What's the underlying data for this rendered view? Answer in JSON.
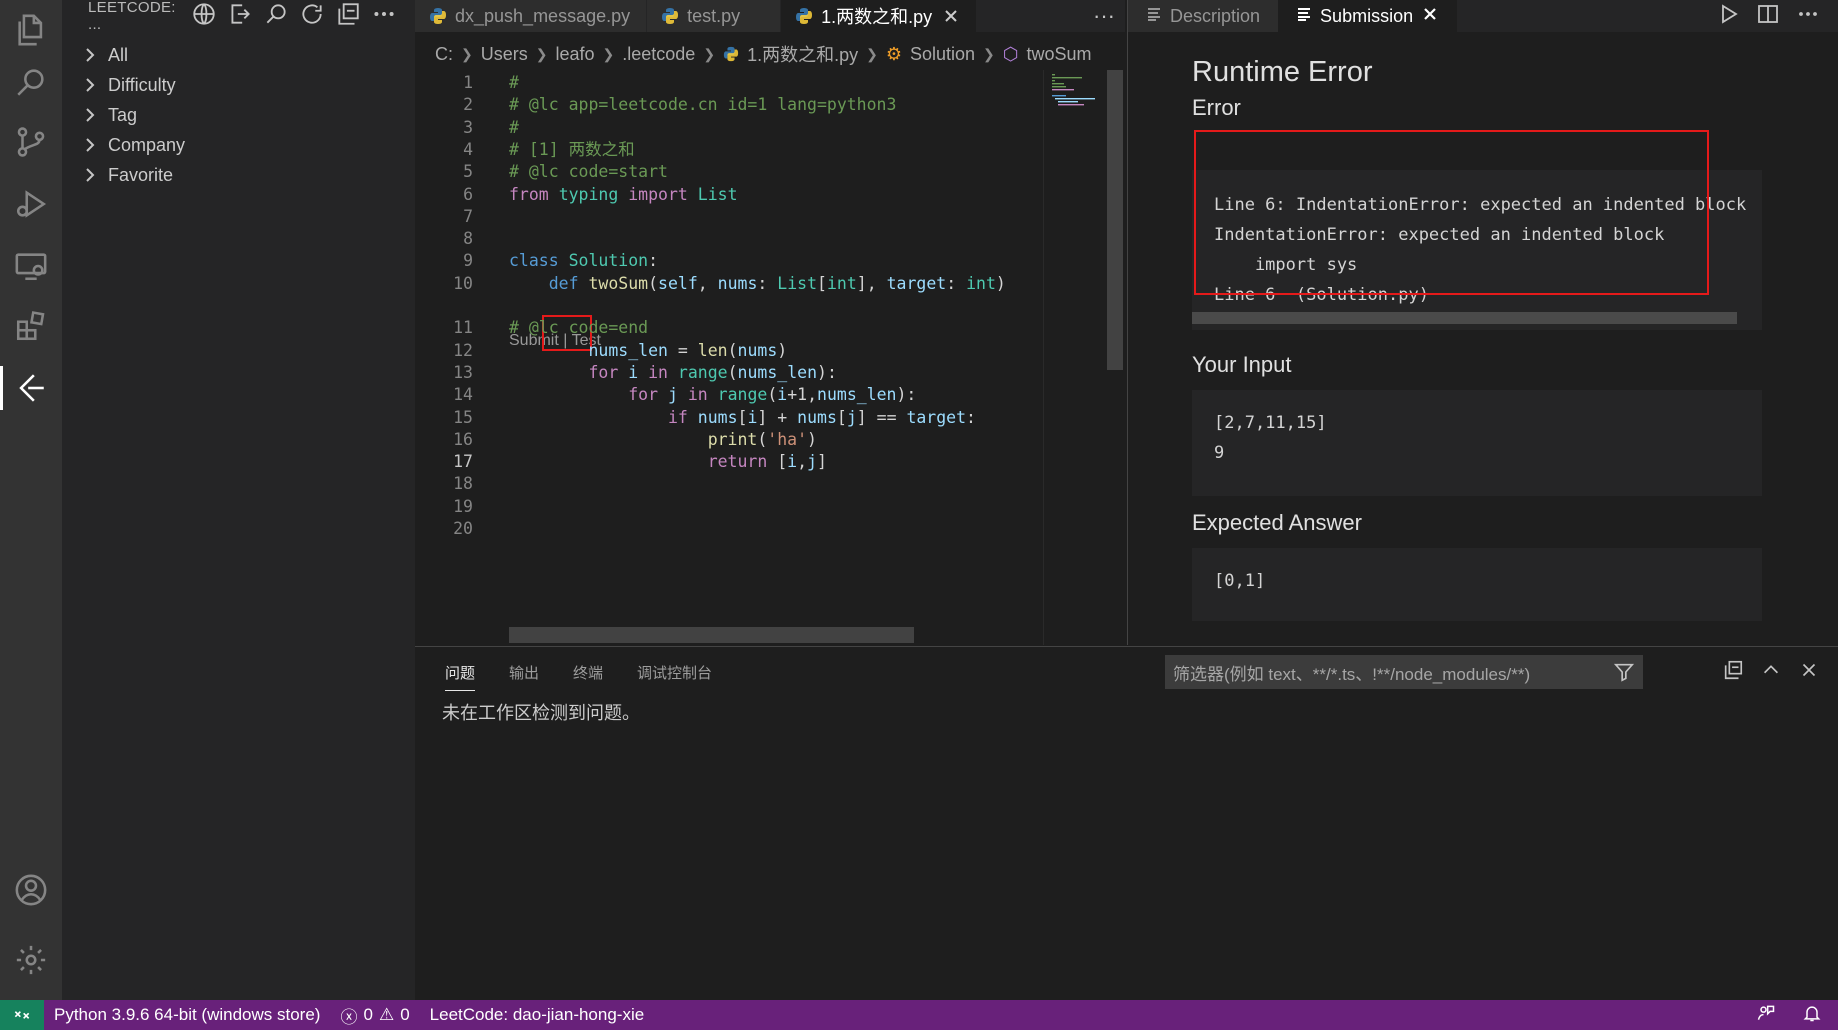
{
  "sidebar": {
    "title": "LEETCODE: ...",
    "items": [
      {
        "label": "All"
      },
      {
        "label": "Difficulty"
      },
      {
        "label": "Tag"
      },
      {
        "label": "Company"
      },
      {
        "label": "Favorite"
      }
    ]
  },
  "editor": {
    "tabs": [
      {
        "label": "dx_push_message.py"
      },
      {
        "label": "test.py"
      },
      {
        "label": "1.两数之和.py"
      }
    ],
    "breadcrumb": [
      "C:",
      "Users",
      "leafo",
      ".leetcode",
      "1.两数之和.py",
      "Solution",
      "twoSum"
    ],
    "codelens": {
      "submit": "Submit",
      "sep": " | ",
      "test": "Test"
    },
    "lines": [
      {
        "n": "1",
        "parts": [
          [
            "c-com",
            "#"
          ]
        ]
      },
      {
        "n": "2",
        "parts": [
          [
            "c-com",
            "# @lc app=leetcode.cn id=1 lang=python3"
          ]
        ]
      },
      {
        "n": "3",
        "parts": [
          [
            "c-com",
            "#"
          ]
        ]
      },
      {
        "n": "4",
        "parts": [
          [
            "c-com",
            "# [1] 两数之和"
          ]
        ]
      },
      {
        "n": "5",
        "parts": [
          [
            "c-com",
            "# @lc code=start"
          ]
        ]
      },
      {
        "n": "6",
        "parts": [
          [
            "c-kw2",
            "from"
          ],
          [
            "c-def",
            " "
          ],
          [
            "c-cls",
            "typing"
          ],
          [
            "c-def",
            " "
          ],
          [
            "c-kw2",
            "import"
          ],
          [
            "c-def",
            " "
          ],
          [
            "c-cls",
            "List"
          ]
        ]
      },
      {
        "n": "7",
        "parts": []
      },
      {
        "n": "8",
        "parts": []
      },
      {
        "n": "9",
        "parts": [
          [
            "c-kw",
            "class"
          ],
          [
            "c-def",
            " "
          ],
          [
            "c-cls",
            "Solution"
          ],
          [
            "c-def",
            ":"
          ]
        ]
      },
      {
        "n": "10",
        "parts": [
          [
            "c-def",
            "    "
          ],
          [
            "c-kw",
            "def"
          ],
          [
            "c-def",
            " "
          ],
          [
            "c-fn",
            "twoSum"
          ],
          [
            "c-def",
            "("
          ],
          [
            "c-var",
            "self"
          ],
          [
            "c-def",
            ", "
          ],
          [
            "c-var",
            "nums"
          ],
          [
            "c-def",
            ": "
          ],
          [
            "c-cls",
            "List"
          ],
          [
            "c-def",
            "["
          ],
          [
            "c-cls",
            "int"
          ],
          [
            "c-def",
            "], "
          ],
          [
            "c-var",
            "target"
          ],
          [
            "c-def",
            ": "
          ],
          [
            "c-cls",
            "int"
          ],
          [
            "c-def",
            ")"
          ]
        ]
      },
      {
        "n": "11",
        "parts": [
          [
            "c-com",
            "# @lc code=end"
          ]
        ]
      },
      {
        "n": "12",
        "parts": [
          [
            "c-def",
            "        "
          ],
          [
            "c-var",
            "nums_len"
          ],
          [
            "c-def",
            " = "
          ],
          [
            "c-fn",
            "len"
          ],
          [
            "c-def",
            "("
          ],
          [
            "c-var",
            "nums"
          ],
          [
            "c-def",
            ")"
          ]
        ]
      },
      {
        "n": "13",
        "parts": [
          [
            "c-def",
            "        "
          ],
          [
            "c-kw2",
            "for"
          ],
          [
            "c-def",
            " "
          ],
          [
            "c-var",
            "i"
          ],
          [
            "c-def",
            " "
          ],
          [
            "c-kw2",
            "in"
          ],
          [
            "c-def",
            " "
          ],
          [
            "c-cls",
            "range"
          ],
          [
            "c-def",
            "("
          ],
          [
            "c-var",
            "nums_len"
          ],
          [
            "c-def",
            "):"
          ]
        ]
      },
      {
        "n": "14",
        "parts": [
          [
            "c-def",
            "            "
          ],
          [
            "c-kw2",
            "for"
          ],
          [
            "c-def",
            " "
          ],
          [
            "c-var",
            "j"
          ],
          [
            "c-def",
            " "
          ],
          [
            "c-kw2",
            "in"
          ],
          [
            "c-def",
            " "
          ],
          [
            "c-cls",
            "range"
          ],
          [
            "c-def",
            "("
          ],
          [
            "c-var",
            "i"
          ],
          [
            "c-def",
            "+1,"
          ],
          [
            "c-var",
            "nums_len"
          ],
          [
            "c-def",
            "):"
          ]
        ]
      },
      {
        "n": "15",
        "parts": [
          [
            "c-def",
            "                "
          ],
          [
            "c-kw2",
            "if"
          ],
          [
            "c-def",
            " "
          ],
          [
            "c-var",
            "nums"
          ],
          [
            "c-def",
            "["
          ],
          [
            "c-var",
            "i"
          ],
          [
            "c-def",
            "] + "
          ],
          [
            "c-var",
            "nums"
          ],
          [
            "c-def",
            "["
          ],
          [
            "c-var",
            "j"
          ],
          [
            "c-def",
            "] == "
          ],
          [
            "c-var",
            "target"
          ],
          [
            "c-def",
            ":"
          ]
        ]
      },
      {
        "n": "16",
        "parts": [
          [
            "c-def",
            "                    "
          ],
          [
            "c-fn",
            "print"
          ],
          [
            "c-def",
            "("
          ],
          [
            "c-str",
            "'ha'"
          ],
          [
            "c-def",
            ")"
          ]
        ]
      },
      {
        "n": "17",
        "parts": [
          [
            "c-def",
            "                    "
          ],
          [
            "c-kw2",
            "return"
          ],
          [
            "c-def",
            " ["
          ],
          [
            "c-var",
            "i"
          ],
          [
            "c-def",
            ","
          ],
          [
            "c-var",
            "j"
          ],
          [
            "c-def",
            "]"
          ]
        ]
      },
      {
        "n": "18",
        "parts": []
      },
      {
        "n": "19",
        "parts": []
      },
      {
        "n": "20",
        "parts": []
      }
    ]
  },
  "right": {
    "tabs": [
      {
        "label": "Description"
      },
      {
        "label": "Submission"
      }
    ],
    "title": "Runtime Error",
    "error_label": "Error",
    "error_text": "Line 6: IndentationError: expected an indented block\nIndentationError: expected an indented block\n    import sys\nLine 6  (Solution.py)",
    "input_label": "Your Input",
    "input_text": "[2,7,11,15]\n9",
    "expected_label": "Expected Answer",
    "expected_text": "[0,1]"
  },
  "panel": {
    "tabs": [
      "问题",
      "输出",
      "终端",
      "调试控制台"
    ],
    "filter_placeholder": "筛选器(例如 text、**/*.ts、!**/node_modules/**)",
    "message": "未在工作区检测到问题。"
  },
  "status": {
    "python": "Python 3.9.6 64-bit (windows store)",
    "errors": "0",
    "warnings": "0",
    "leetcode": "LeetCode: dao-jian-hong-xie"
  },
  "colors": {
    "statusbar": "#68217a",
    "remote": "#16825d",
    "highlight_box": "#e51a1a"
  }
}
